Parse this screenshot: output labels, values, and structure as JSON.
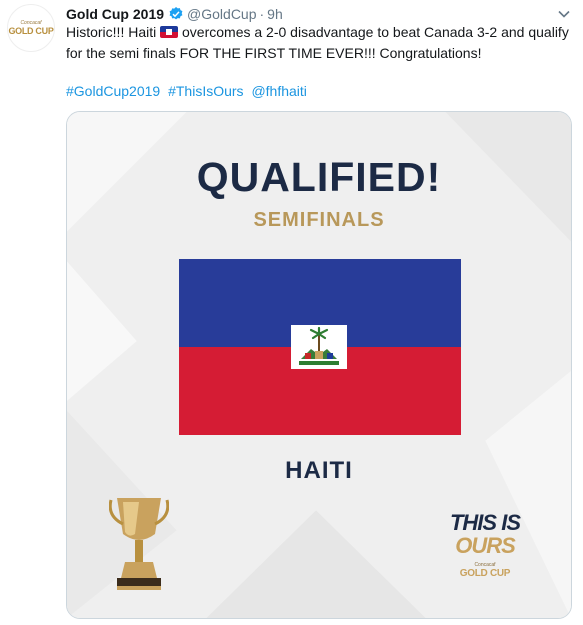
{
  "tweet": {
    "author_name": "Gold Cup 2019",
    "handle": "@GoldCup",
    "separator": "·",
    "time": "9h",
    "avatar": {
      "small_text": "Concacaf",
      "main_text": "GOLD CUP"
    },
    "text_before_flag": "Historic!!! Haiti ",
    "text_after_flag": " overcomes a 2-0 disadvantage to beat Canada 3-2 and qualify for the semi finals FOR THE FIRST TIME EVER!!! Congratulations!",
    "hashtags": [
      "#GoldCup2019",
      "#ThisIsOurs",
      "@fhfhaiti"
    ]
  },
  "card": {
    "headline": "QUALIFIED!",
    "subline": "SEMIFINALS",
    "country": "HAITI",
    "slogan_line1": "THIS IS",
    "slogan_line2": "OURS",
    "slogan_small": "Concacaf",
    "slogan_brand": "GOLD CUP"
  },
  "colors": {
    "navy": "#1c2a45",
    "gold": "#b8985a",
    "flag_blue": "#283c99",
    "flag_red": "#d51c34",
    "link": "#1b95e0",
    "verified": "#1da1f2"
  },
  "icons": [
    "verified-badge-icon",
    "chevron-down-icon",
    "haiti-flag-emoji-icon",
    "trophy-icon"
  ]
}
